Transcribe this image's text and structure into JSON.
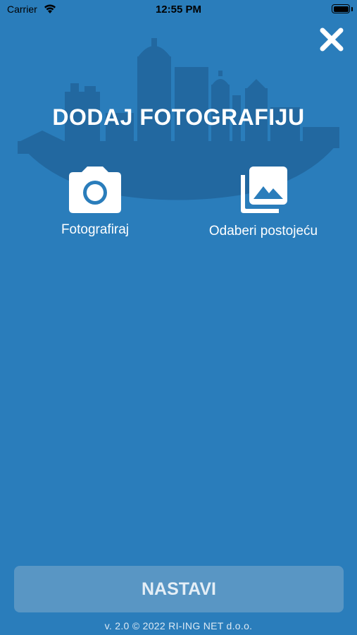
{
  "status_bar": {
    "carrier": "Carrier",
    "time": "12:55 PM"
  },
  "header": {
    "title": "DODAJ FOTOGRAFIJU"
  },
  "options": {
    "camera_label": "Fotografiraj",
    "gallery_label": "Odaberi postojeću"
  },
  "footer": {
    "continue_label": "NASTAVI",
    "version": "v. 2.0 © 2022 RI-ING NET d.o.o."
  },
  "icons": {
    "close": "close-icon",
    "camera": "camera-icon",
    "gallery": "gallery-icon"
  },
  "colors": {
    "background": "#2a7dbb",
    "skyline": "#2268a0",
    "button": "#5996c4",
    "text": "#ffffff"
  }
}
